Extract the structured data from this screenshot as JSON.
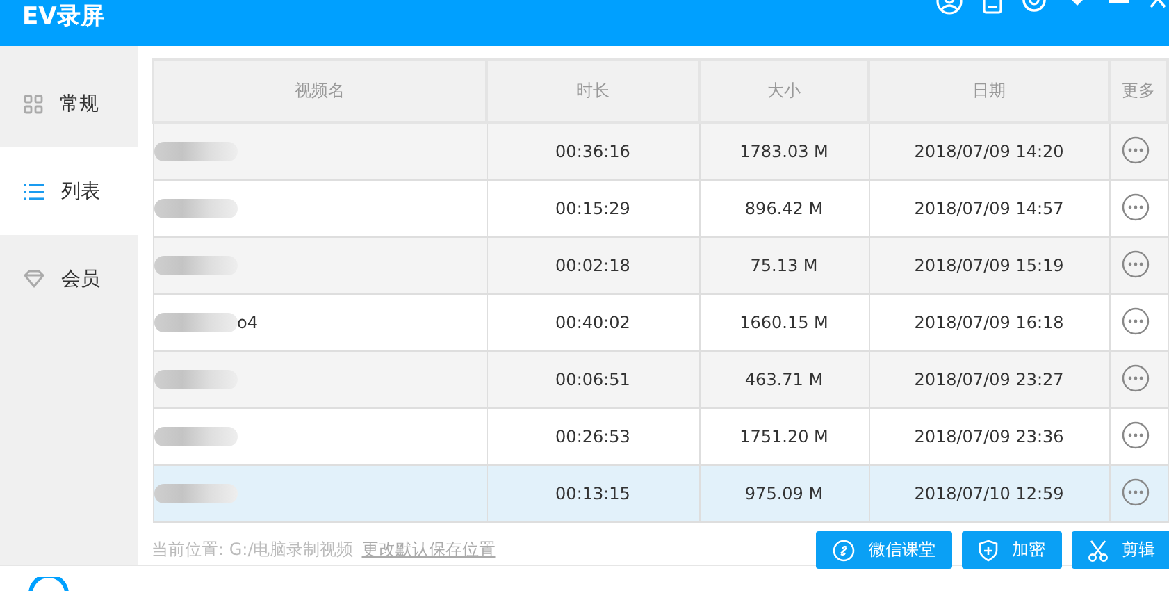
{
  "window": {
    "title": "EV录屏"
  },
  "sidebar": {
    "items": [
      {
        "label": "常规",
        "selected": false
      },
      {
        "label": "列表",
        "selected": true
      },
      {
        "label": "会员",
        "selected": false
      }
    ]
  },
  "table": {
    "columns": [
      "视频名",
      "时长",
      "大小",
      "日期",
      "更多"
    ],
    "rows": [
      {
        "duration": "00:36:16",
        "size": "1783.03 M",
        "date": "2018/07/09 14:20",
        "selected": false
      },
      {
        "duration": "00:15:29",
        "size": "896.42 M",
        "date": "2018/07/09 14:57",
        "selected": false
      },
      {
        "duration": "00:02:18",
        "size": "75.13 M",
        "date": "2018/07/09 15:19",
        "selected": false
      },
      {
        "name": "o4",
        "duration": "00:40:02",
        "size": "1660.15 M",
        "date": "2018/07/09 16:18",
        "selected": false
      },
      {
        "duration": "00:06:51",
        "size": "463.71 M",
        "date": "2018/07/09 23:27",
        "selected": false
      },
      {
        "duration": "00:26:53",
        "size": "1751.20 M",
        "date": "2018/07/09 23:36",
        "selected": false
      },
      {
        "duration": "00:13:15",
        "size": "975.09 M",
        "date": "2018/07/10 12:59",
        "selected": true
      }
    ]
  },
  "footer": {
    "location": "当前位置: G:/电脑录制视频",
    "change_link": "更改默认保存位置"
  },
  "actions": [
    {
      "label": "微信课堂"
    },
    {
      "label": "加密"
    },
    {
      "label": "剪辑"
    }
  ]
}
